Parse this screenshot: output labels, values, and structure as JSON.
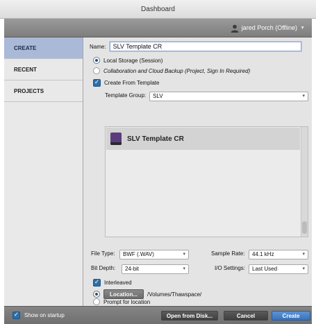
{
  "window": {
    "title": "Dashboard"
  },
  "user": {
    "label": "jared Porch (Offline)"
  },
  "sidebar": {
    "items": [
      {
        "label": "CREATE"
      },
      {
        "label": "RECENT"
      },
      {
        "label": "PROJECTS"
      }
    ]
  },
  "form": {
    "name_label": "Name:",
    "name_value": "SLV Template CR",
    "storage_local": "Local Storage (Session)",
    "storage_cloud": "Collaboration and Cloud Backup (Project, Sign In Required)",
    "create_from_template": "Create From Template",
    "template_group_label": "Template Group:",
    "template_group_value": "SLV",
    "template_item": "SLV Template CR",
    "file_type_label": "File Type:",
    "file_type_value": "BWF (.WAV)",
    "sample_rate_label": "Sample Rate:",
    "sample_rate_value": "44.1 kHz",
    "bit_depth_label": "Bit Depth:",
    "bit_depth_value": "24-bit",
    "io_settings_label": "I/O Settings:",
    "io_settings_value": "Last Used",
    "interleaved": "Interleaved",
    "prompt_location": "Prompt for location",
    "location_button": "Location...",
    "location_path": "/Volumes/Thawspace/"
  },
  "footer": {
    "show_on_startup": "Show on startup",
    "open_from_disk": "Open from Disk...",
    "cancel": "Cancel",
    "create": "Create"
  },
  "colors": {
    "accent": "#3a72b8",
    "sidebar_active": "#aab9d8",
    "check": "#2f6fa8"
  }
}
